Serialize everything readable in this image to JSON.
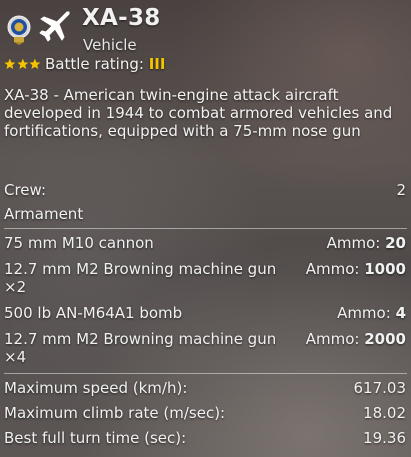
{
  "header": {
    "title": "XA-38",
    "subtitle": "Vehicle",
    "battle_rating_label": "Battle rating:",
    "battle_rating_value": "III",
    "star_color": "#f5c400",
    "icons": [
      "medal-icon",
      "aircraft-icon",
      "star-icon"
    ]
  },
  "description": "XA-38 - American twin-engine attack aircraft developed in 1944 to combat armored vehicles and fortifications, equipped with a 75-mm nose gun",
  "crew": {
    "label": "Crew:",
    "value": "2"
  },
  "armament": {
    "heading": "Armament",
    "ammo_label": "Ammo:",
    "weapons": [
      {
        "name": "75 mm M10 cannon",
        "suffix": "",
        "ammo": "20"
      },
      {
        "name": "12.7 mm M2 Browning machine gun",
        "suffix": "×2",
        "ammo": "1000"
      },
      {
        "name": "500 lb AN-M64A1 bomb",
        "suffix": "",
        "ammo": "4"
      },
      {
        "name": "12.7 mm M2 Browning machine gun",
        "suffix": "×4",
        "ammo": "2000"
      }
    ]
  },
  "stats": [
    {
      "label": "Maximum speed (km/h):",
      "value": "617.03"
    },
    {
      "label": "Maximum climb rate (m/sec):",
      "value": "18.02"
    },
    {
      "label": "Best full turn time (sec):",
      "value": "19.36"
    }
  ]
}
